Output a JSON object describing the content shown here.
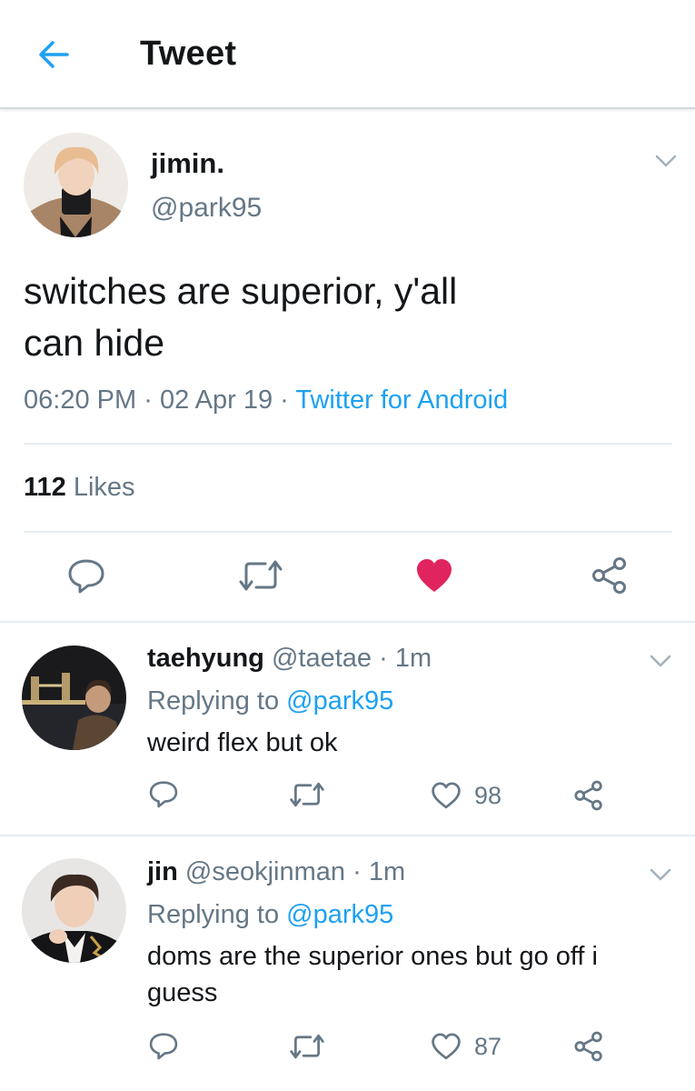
{
  "header": {
    "title": "Tweet"
  },
  "tweet": {
    "display_name": "jimin.",
    "handle": "@park95",
    "text_line1": "switches are superior, y'all",
    "text_line2": "can hide",
    "time": "06:20 PM",
    "date": "02 Apr 19",
    "sep": "·",
    "source": "Twitter for Android",
    "likes_count": "112",
    "likes_label": "Likes",
    "liked": true
  },
  "replies": [
    {
      "display_name": "taehyung",
      "handle": "@taetae",
      "sep": "·",
      "time": "1m",
      "replying_prefix": "Replying to",
      "replying_to": "@park95",
      "text": "weird flex but ok",
      "likes": "98"
    },
    {
      "display_name": "jin",
      "handle": "@seokjinman",
      "sep": "·",
      "time": "1m",
      "replying_prefix": "Replying to",
      "replying_to": "@park95",
      "text": "doms are the superior ones but go off i guess",
      "likes": "87"
    }
  ],
  "colors": {
    "accent": "#1da1f2",
    "like": "#e0245e",
    "secondary_text": "#657786",
    "icon": "#657786"
  }
}
